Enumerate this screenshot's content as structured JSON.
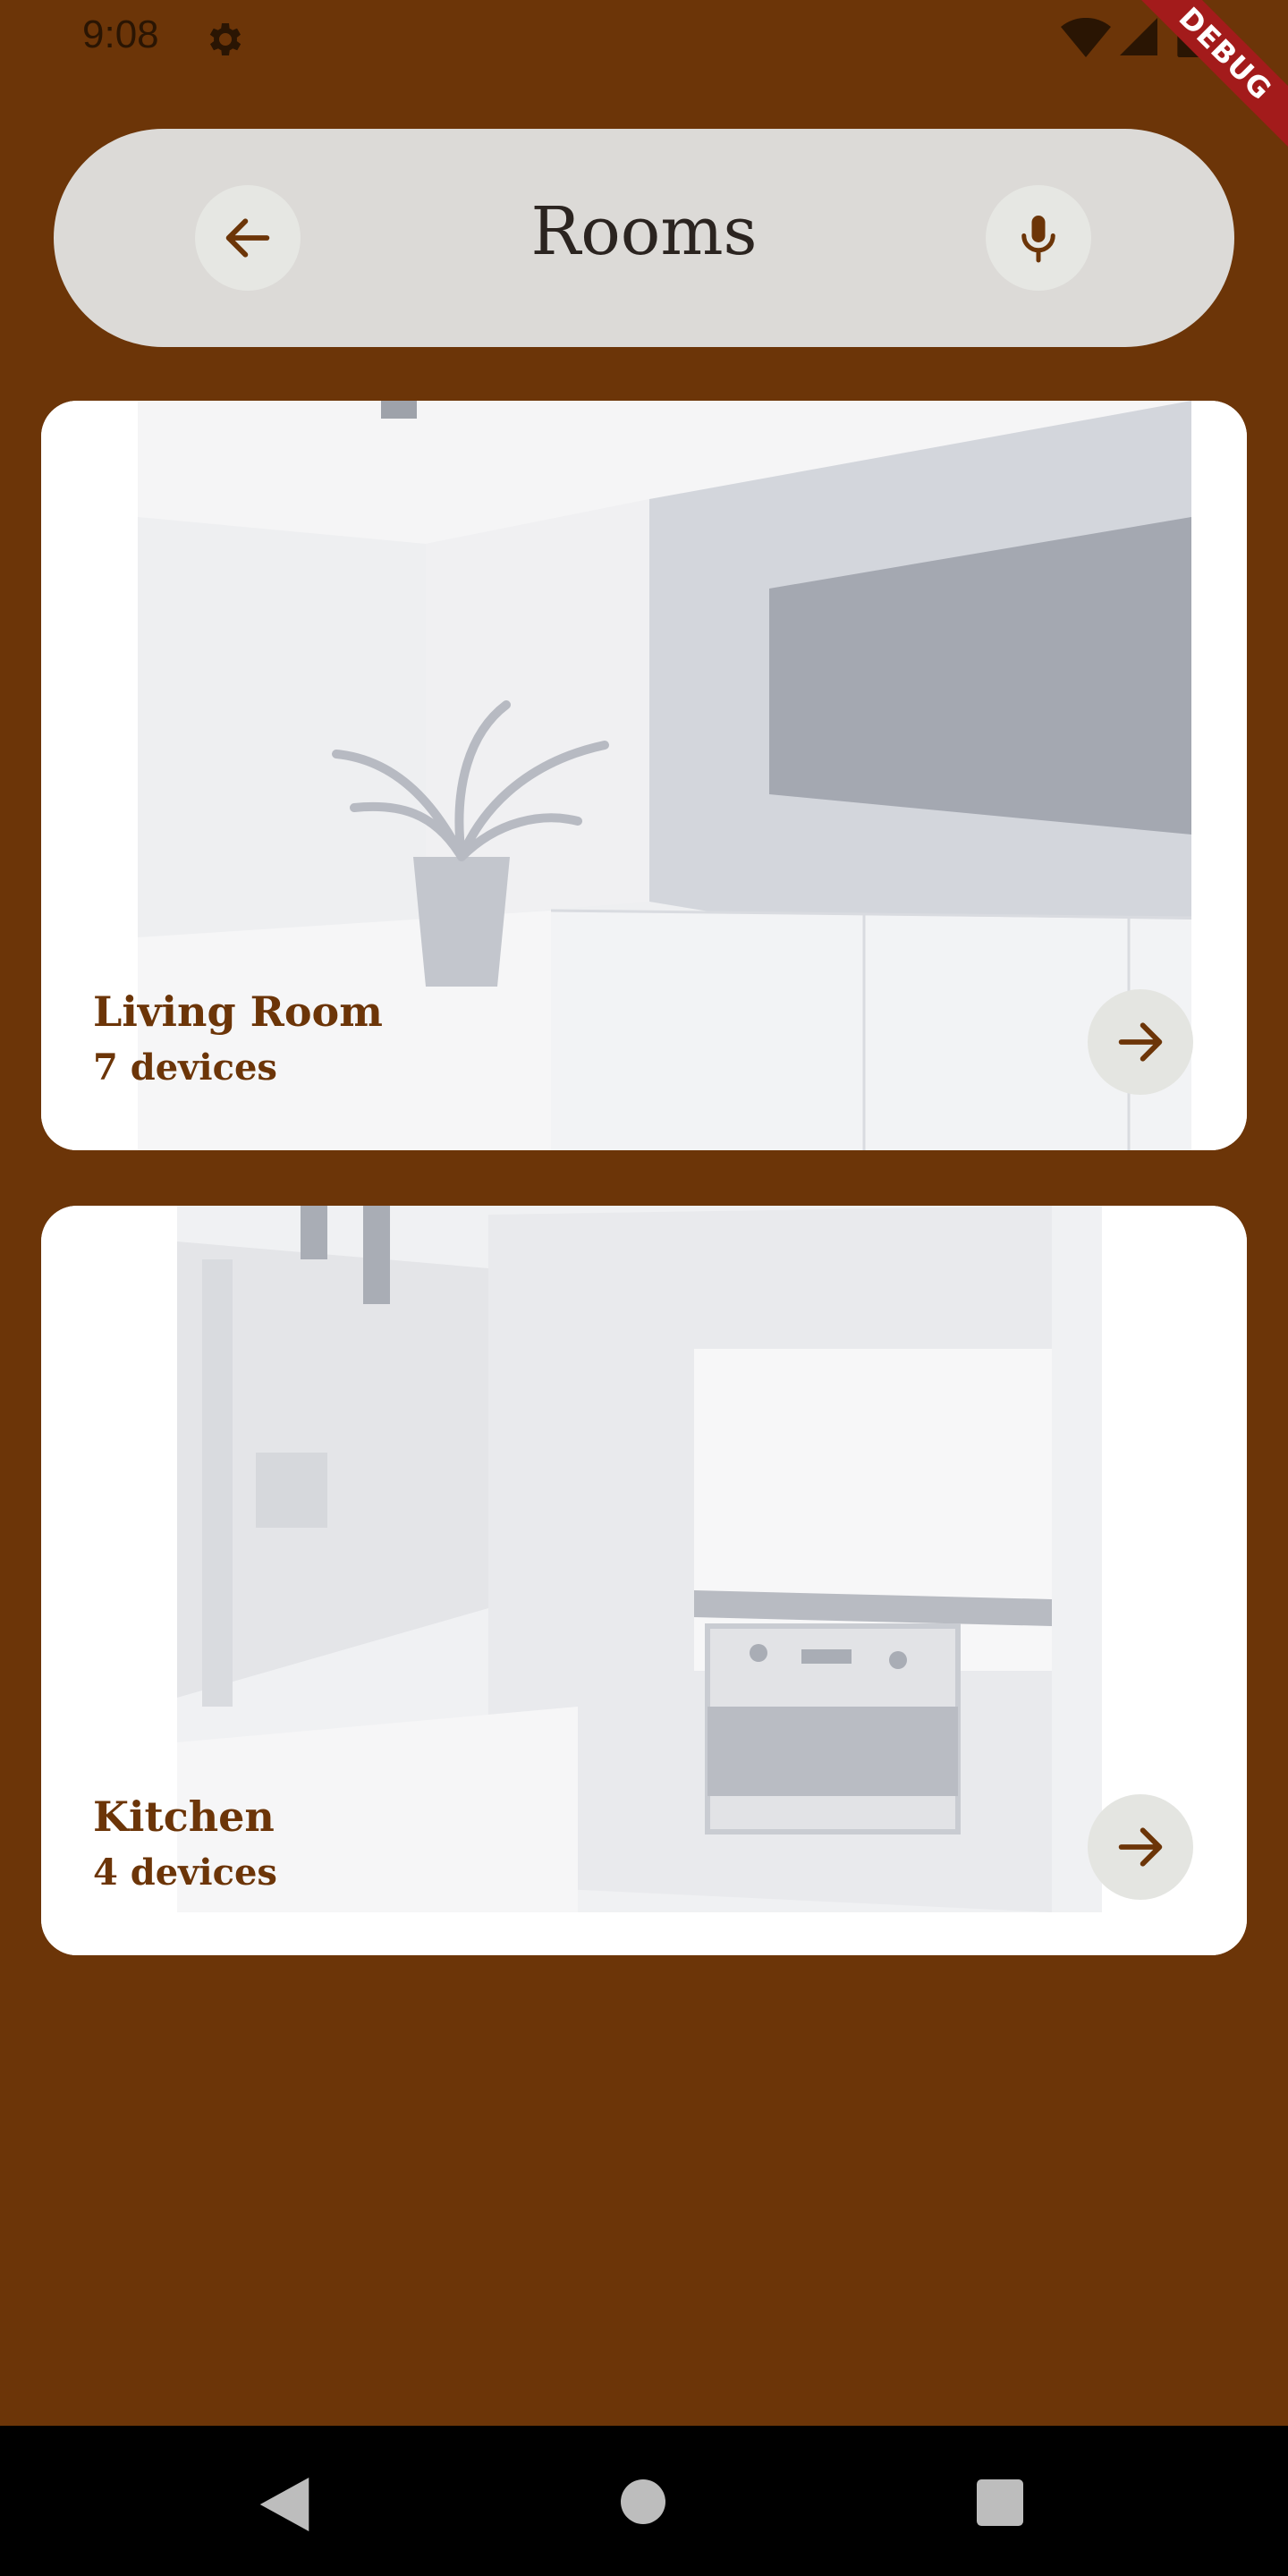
{
  "status_bar": {
    "time": "9:08",
    "icons": [
      "gear-icon",
      "wifi-icon",
      "signal-icon",
      "battery-icon"
    ],
    "debug_label": "DEBUG"
  },
  "search_bar": {
    "title": "Rooms",
    "back_icon": "arrow-left-icon",
    "mic_icon": "microphone-icon"
  },
  "rooms": [
    {
      "name": "Living Room",
      "devices": "7 devices",
      "image": "living-room-illustration",
      "action_icon": "arrow-right-icon"
    },
    {
      "name": "Kitchen",
      "devices": "4 devices",
      "image": "kitchen-illustration",
      "action_icon": "arrow-right-icon"
    }
  ],
  "nav_bar": {
    "icons": [
      "nav-back-icon",
      "nav-home-icon",
      "nav-recents-icon"
    ]
  },
  "colors": {
    "background": "#6c3508",
    "accent": "#6c3508",
    "search_bar": "#dcdad7",
    "card": "#ffffff",
    "button": "#e6e7e3",
    "debug_ribbon": "#a31b1b"
  }
}
